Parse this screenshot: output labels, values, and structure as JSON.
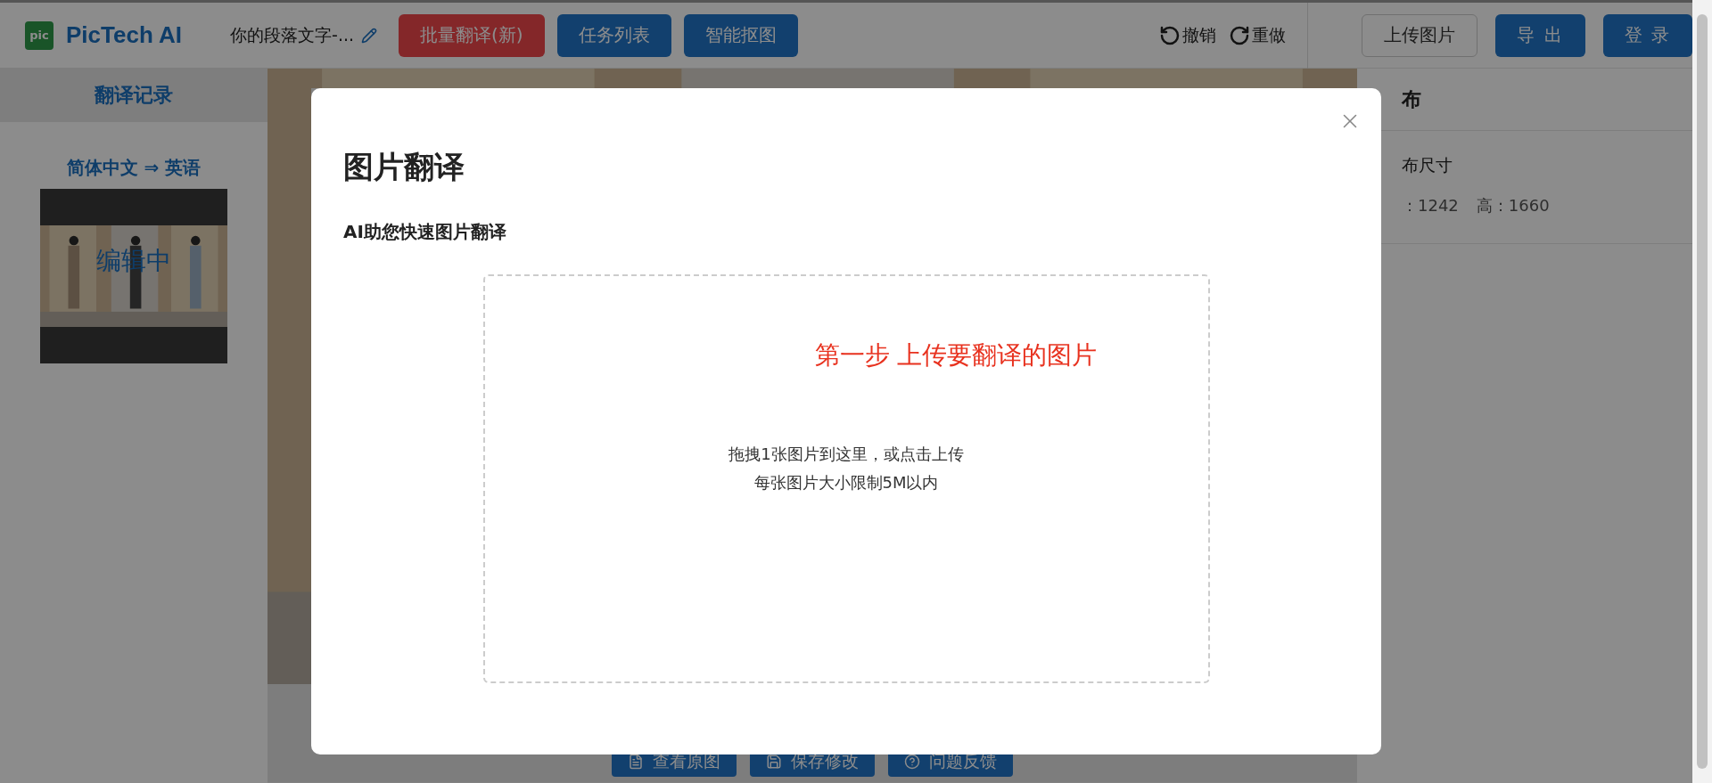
{
  "header": {
    "logo_badge": "pic",
    "brand": "PicTech AI",
    "document_title": "你的段落文字-...",
    "tool_buttons": [
      {
        "label": "批量翻译(新)",
        "kind": "danger"
      },
      {
        "label": "任务列表",
        "kind": "primary"
      },
      {
        "label": "智能抠图",
        "kind": "primary"
      }
    ],
    "history": [
      {
        "label": "撤销",
        "kind": "undo"
      },
      {
        "label": "重做",
        "kind": "redo"
      }
    ],
    "action_buttons": [
      {
        "label": "上传图片",
        "kind": "outline"
      },
      {
        "label": "导 出",
        "kind": "primary"
      },
      {
        "label": "登 录",
        "kind": "primary"
      }
    ]
  },
  "sidebar": {
    "title": "翻译记录",
    "records": [
      {
        "title": "简体中文 ⇒ 英语",
        "status": "编辑中"
      }
    ]
  },
  "canvas": {
    "bottom_actions": [
      {
        "label": "查看原图",
        "kind": "document"
      },
      {
        "label": "保存修改",
        "kind": "save"
      },
      {
        "label": "问题反馈",
        "kind": "help"
      }
    ]
  },
  "right_panel": {
    "title": "布",
    "section_label": "布尺寸",
    "width_value": "：1242",
    "height_value": "高：1660"
  },
  "modal": {
    "title": "图片翻译",
    "subtitle": "AI助您快速图片翻译",
    "step_text": "第一步 上传要翻译的图片",
    "hint_lines": [
      "拖拽1张图片到这里，或点击上传",
      "每张图片大小限制5M以内"
    ]
  }
}
